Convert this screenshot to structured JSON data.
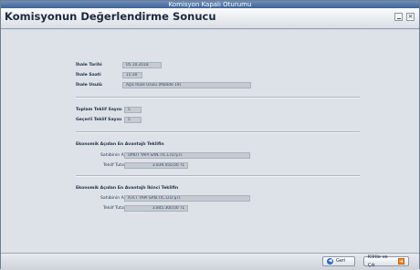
{
  "window": {
    "title": "Komisyon Kapalı Oturumu"
  },
  "header": {
    "page_title": "Komisyonun Değerlendirme Sonucu"
  },
  "ihale": {
    "tarih_label": "İhale Tarihi",
    "tarih_value": "05.10.2018",
    "saat_label": "İhale Saati",
    "saat_value": "15:30",
    "usul_label": "İhale Usulü",
    "usul_value": "Açık İhale Usulü (Madde 19)"
  },
  "teklif": {
    "toplam_label": "Toplam Teklif Sayısı",
    "toplam_value": "5",
    "gecerli_label": "Geçerli Teklif Sayısı",
    "gecerli_value": "5"
  },
  "en_avantajli": {
    "section_title": "Ekonomik Açıdan En Avantajlı Teklifin",
    "sahip_label": "Sahibinin Adı",
    "sahip_value": "UMUT YAPI SAN.TİC.LTD.ŞTİ.",
    "tutar_label": "Teklif Tutarı",
    "tutar_value": "3.839.450,00 TL"
  },
  "ikinci": {
    "section_title": "Ekonomik Açıdan En Avantajlı İkinci Teklifin",
    "sahip_label": "Sahibinin Adı",
    "sahip_value": "A.R.T YAPI SAN.TİC.LTD.ŞTİ.",
    "tutar_label": "Teklif Tutarı",
    "tutar_value": "3.845.300,00 TL"
  },
  "footer": {
    "back_label": "Geri",
    "save_exit_label": "Kilitle ve Çık"
  }
}
